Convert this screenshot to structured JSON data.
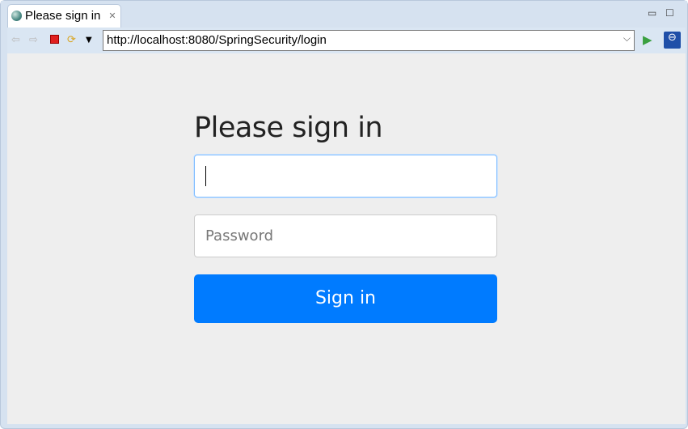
{
  "tab": {
    "title": "Please sign in",
    "close_icon": "close-icon"
  },
  "toolbar": {
    "url": "http://localhost:8080/SpringSecurity/login"
  },
  "page": {
    "heading": "Please sign in",
    "username_placeholder": "",
    "password_placeholder": "Password",
    "signin_label": "Sign in",
    "accent": "#007bff"
  }
}
